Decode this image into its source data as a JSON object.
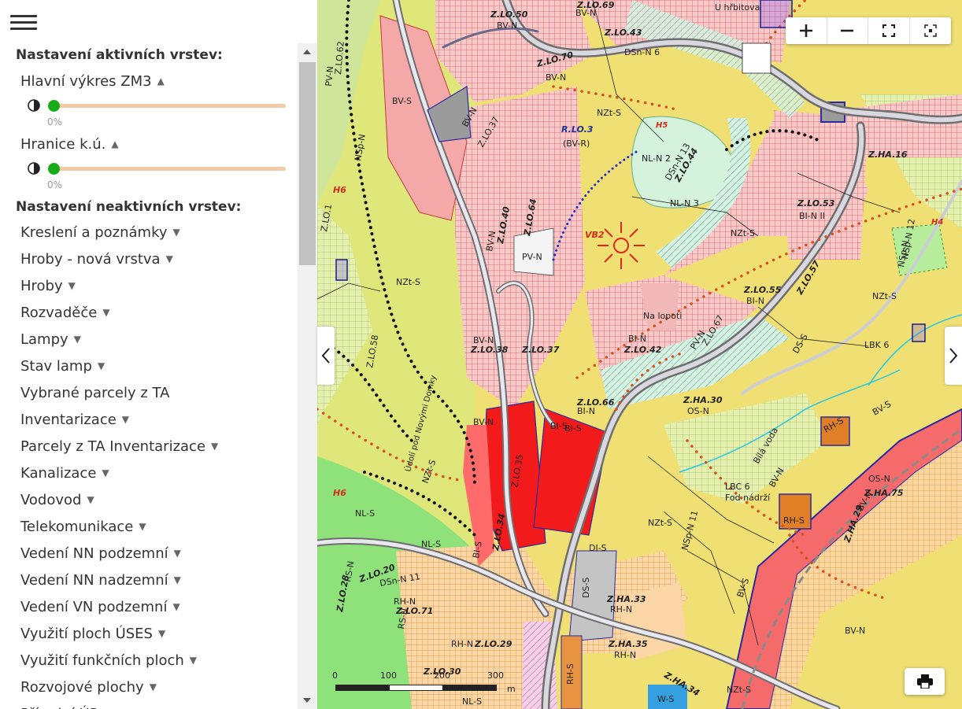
{
  "panel": {
    "active_title": "Nastavení aktivních vrstev:",
    "inactive_title": "Nastavení neaktivních vrstev:",
    "active_layers": [
      {
        "label": "Hlavní výkres ZM3",
        "opacity": 0,
        "opacity_text": "0%"
      },
      {
        "label": "Hranice k.ú.",
        "opacity": 0,
        "opacity_text": "0%"
      }
    ],
    "inactive_layers": [
      "Kreslení a poznámky",
      "Hroby - nová vrstva",
      "Hroby",
      "Rozvaděče",
      "Lampy",
      "Stav lamp",
      "Vybrané parcely z TA",
      "Inventarizace",
      "Parcely z TA Inventarizace",
      "Kanalizace",
      "Vodovod",
      "Telekomunikace",
      "Vedení NN podzemní",
      "Vedení NN nadzemní",
      "Vedení VN podzemní",
      "Využití ploch ÚSES",
      "Využití funkčních ploch",
      "Rozvojové plochy",
      "Přírodní ÚP"
    ],
    "inactive_no_caret": [
      6
    ],
    "caret_up": "▲",
    "caret_down": "▼"
  },
  "map": {
    "scale": {
      "ticks": [
        "0",
        "100",
        "200",
        "300"
      ],
      "unit": "m"
    },
    "labels": [
      "Z.LO.50",
      "BV-N",
      "Z.LO.69",
      "BV-N",
      "U hřbitova",
      "Z.LO.43",
      "DSn-N 6",
      "Z.LO.70",
      "BV-N",
      "BV-S",
      "PV-N",
      "Z.LO.62",
      "BV-N",
      "Z.LO.37",
      "NZt-S",
      "R.LO.3",
      "(BV-R)",
      "H5",
      "NL-N 2",
      "NL-N 3",
      "DSn-N 13",
      "Z.LO.44",
      "Z.LO.53",
      "BI-N II",
      "Z.HA.16",
      "H4",
      "NZt-S",
      "NSp-N",
      "H6",
      "NSp-N",
      "Z.LO.1",
      "Z.LO.40",
      "BV-N",
      "Z.LO.64",
      "PV-N",
      "VB2",
      "Z.LO.42",
      "NZt-S",
      "Z.LO.55",
      "BI-N",
      "Z.LO.57",
      "NSp-N 12",
      "NZt-S",
      "Na lopoti",
      "BI-N",
      "Z.LO.42",
      "Z.LO.67",
      "PV-N",
      "DS-S",
      "LBK 6",
      "Z.LO.58",
      "BV-N",
      "Z.LO.38",
      "Z.LO.37",
      "BV-N",
      "BI-S",
      "Z.LO.66",
      "BI-N",
      "Z.HA.30",
      "OS-N",
      "BV-S",
      "RH-S",
      "Bílá voda",
      "BV-N",
      "Z.LO.35",
      "BI-S",
      "H6",
      "NZt-S",
      "LBC 6",
      "Fod nádrží",
      "NSp-N 11",
      "NZt-S",
      "OS-N",
      "Z.HA.75",
      "RH-S",
      "NL-S",
      "Z.LO.20",
      "DSn-N 11",
      "NL-S",
      "BI-S",
      "Z.LO.34",
      "DI-S",
      "DS-S",
      "Z.HA.33",
      "RH-N",
      "BV-N",
      "Z.HA.29",
      "RS-N",
      "Z.LO.28",
      "RH-N",
      "Z.LO.71",
      "RS-N",
      "RH-N",
      "Z.LO.29",
      "Z.LO.30",
      "NL-S",
      "Z.HA.35",
      "RH-N",
      "RH-S",
      "Z.HA.34",
      "NZt-S",
      "BV-S",
      "BV-N",
      "W-S",
      "Údolí pod Novými Domky"
    ]
  }
}
